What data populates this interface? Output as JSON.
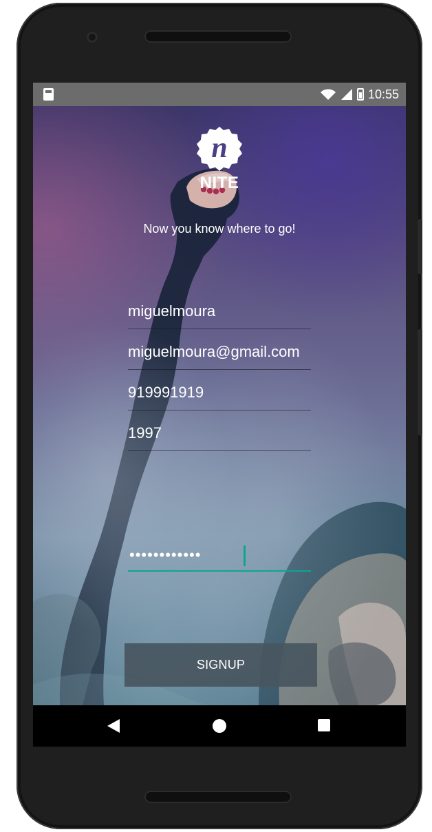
{
  "statusbar": {
    "time": "10:55",
    "icons": [
      "sd-card-icon",
      "wifi-icon",
      "signal-icon",
      "battery-icon"
    ]
  },
  "app": {
    "brand": "NITE",
    "logo_glyph": "n",
    "tagline": "Now you know where to go!"
  },
  "form": {
    "username": "miguelmoura",
    "email": "miguelmoura@gmail.com",
    "phone": "919991919",
    "year": "1997",
    "password": "••••••••••••",
    "signup_label": "SIGNUP"
  },
  "colors": {
    "accent": "#0ea58f",
    "button": "#485660",
    "statusbar": "#6c6c6c",
    "navbar": "#000000"
  },
  "navigation": {
    "icons": [
      "back-icon",
      "home-icon",
      "recents-icon"
    ]
  }
}
